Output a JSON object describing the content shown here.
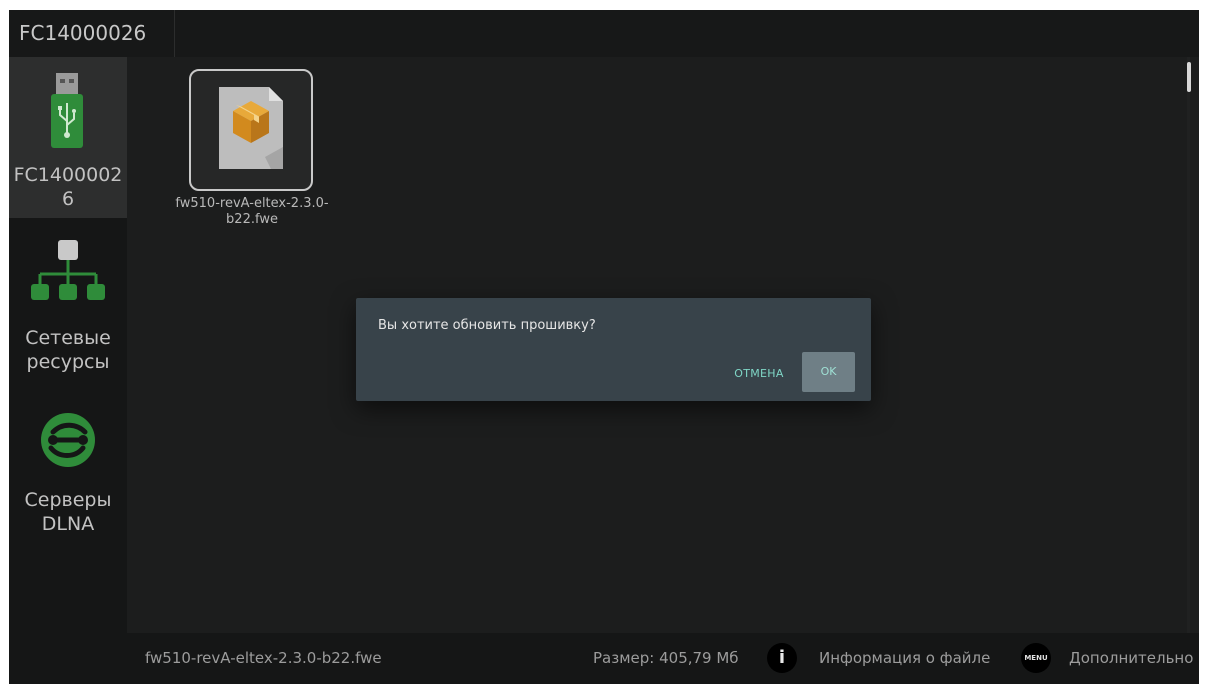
{
  "topbar": {
    "tab_label": "FC14000026"
  },
  "sidebar": {
    "items": [
      {
        "label_line1": "FC1400002",
        "label_line2": "6",
        "icon": "usb-drive-icon"
      },
      {
        "label_line1": "Сетевые",
        "label_line2": "ресурсы",
        "icon": "network-tree-icon"
      },
      {
        "label_line1": "Серверы",
        "label_line2": "DLNA",
        "icon": "dlna-icon"
      }
    ]
  },
  "content": {
    "file": {
      "name_line1": "fw510-revA-eltex-2.3.0-",
      "name_line2": "b22.fwe",
      "icon": "package-file-icon"
    }
  },
  "dialog": {
    "message": "Вы хотите обновить прошивку?",
    "cancel_label": "ОТМЕНА",
    "ok_label": "OK"
  },
  "bottombar": {
    "file_name": "fw510-revA-eltex-2.3.0-b22.fwe",
    "size": "Размер: 405,79 Мб",
    "info_icon_glyph": "i",
    "info_label": "Информация о файле",
    "menu_icon_text": "MENU",
    "more_label": "Дополнительно"
  },
  "colors": {
    "accent_green": "#2f8c3a",
    "dialog_bg": "#38434a",
    "button_text": "#7fd6c6"
  }
}
